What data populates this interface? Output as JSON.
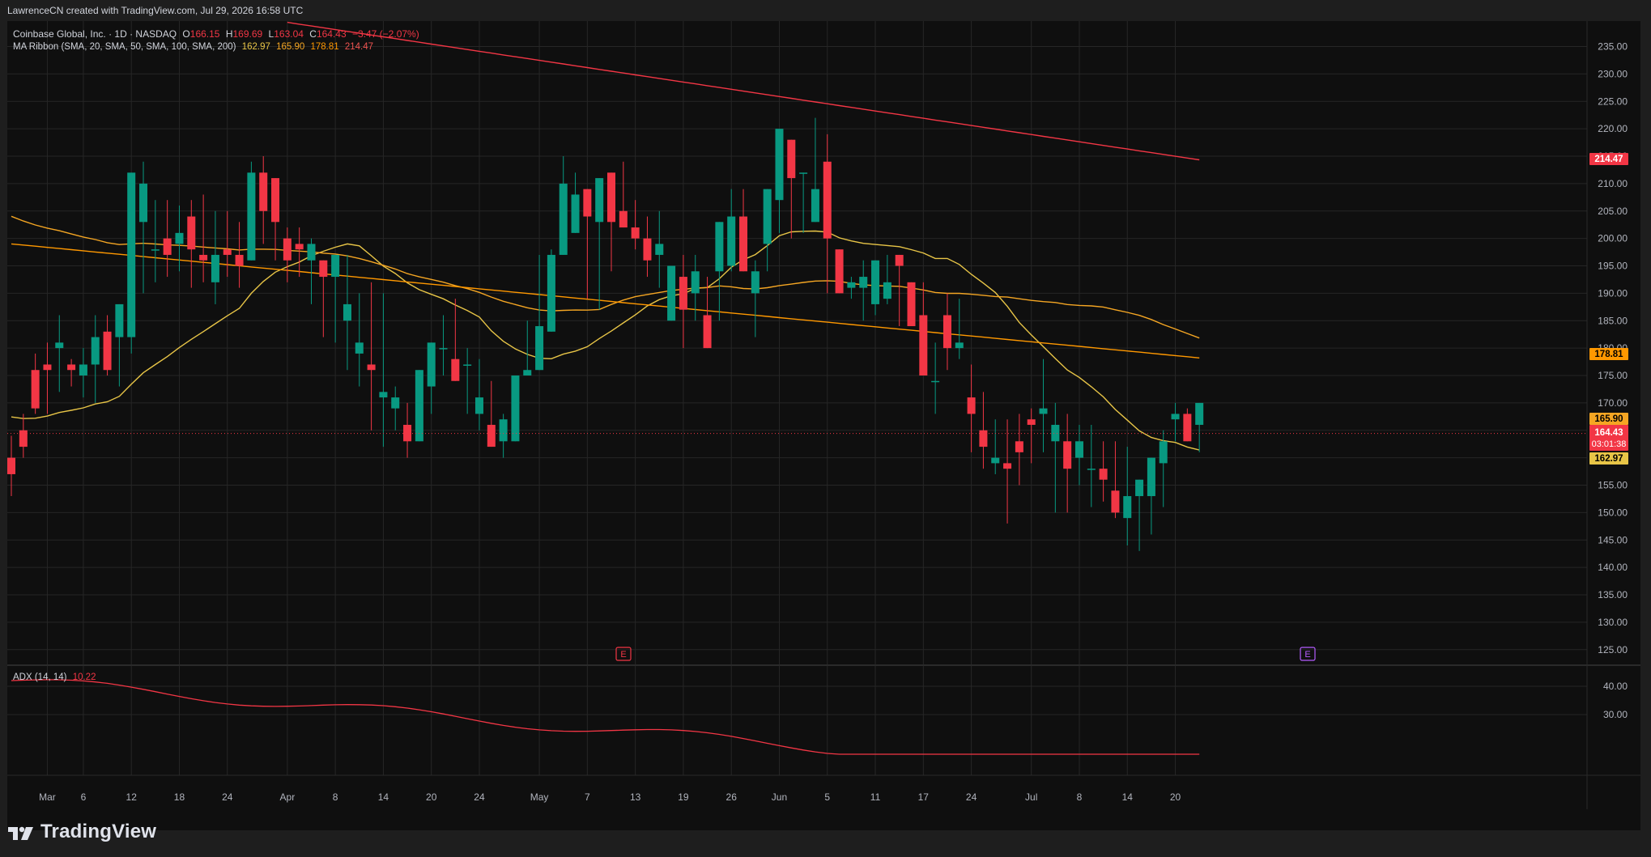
{
  "header": {
    "attribution": "LawrenceCN created with TradingView.com, Jul 29, 2026 16:58 UTC"
  },
  "legend": {
    "symbol": "Coinbase Global, Inc. · 1D · NASDAQ",
    "o_label": "O",
    "o": "166.15",
    "h_label": "H",
    "h": "169.69",
    "l_label": "L",
    "l": "163.04",
    "c_label": "C",
    "c": "164.43",
    "change": "−3.47 (−2.07%)",
    "ma_label": "MA Ribbon (SMA, 20, SMA, 50, SMA, 100, SMA, 200)",
    "ma20": "162.97",
    "ma50": "165.90",
    "ma100": "178.81",
    "ma200": "214.47"
  },
  "adx": {
    "label": "ADX (14, 14)",
    "value": "10.22"
  },
  "price_badges": {
    "ma200": "214.47",
    "ma100": "178.81",
    "ma50": "165.90",
    "last": "164.43",
    "countdown": "03:01:38",
    "ma20": "162.97"
  },
  "earnings_markers": [
    {
      "label": "E"
    },
    {
      "label": "E"
    }
  ],
  "logo": {
    "text": "TradingView"
  },
  "colors": {
    "background": "#0f0f0f",
    "frame": "#1e1e1e",
    "grid": "#262626",
    "up": "#089981",
    "down": "#f23645",
    "ma20": "#e8c547",
    "ma50": "#f5a623",
    "ma100": "#ff9800",
    "ma200": "#f23645",
    "adx": "#f23645",
    "text": "#b2b5be"
  },
  "chart_data": {
    "type": "candlestick",
    "price_axis": {
      "min": 120,
      "max": 237,
      "ticks": [
        "125.00",
        "130.00",
        "135.00",
        "140.00",
        "145.00",
        "150.00",
        "155.00",
        "160.00",
        "165.00",
        "170.00",
        "175.00",
        "180.00",
        "185.00",
        "190.00",
        "195.00",
        "200.00",
        "205.00",
        "210.00",
        "215.00",
        "220.00",
        "225.00",
        "230.00",
        "235.00"
      ]
    },
    "adx_axis": {
      "ticks": [
        "40.00",
        "30.00"
      ]
    },
    "time_axis": {
      "labels": [
        {
          "t": "Mar",
          "i": 3
        },
        {
          "t": "6",
          "i": 6
        },
        {
          "t": "12",
          "i": 10
        },
        {
          "t": "18",
          "i": 14
        },
        {
          "t": "24",
          "i": 18
        },
        {
          "t": "Apr",
          "i": 23
        },
        {
          "t": "8",
          "i": 27
        },
        {
          "t": "14",
          "i": 31
        },
        {
          "t": "20",
          "i": 35
        },
        {
          "t": "24",
          "i": 39
        },
        {
          "t": "May",
          "i": 44
        },
        {
          "t": "7",
          "i": 48
        },
        {
          "t": "13",
          "i": 52
        },
        {
          "t": "19",
          "i": 56
        },
        {
          "t": "26",
          "i": 60
        },
        {
          "t": "Jun",
          "i": 64
        },
        {
          "t": "5",
          "i": 68
        },
        {
          "t": "11",
          "i": 72
        },
        {
          "t": "17",
          "i": 76
        },
        {
          "t": "24",
          "i": 80
        },
        {
          "t": "Jul",
          "i": 85
        },
        {
          "t": "8",
          "i": 89
        },
        {
          "t": "14",
          "i": 93
        },
        {
          "t": "20",
          "i": 97
        }
      ]
    },
    "candles": [
      [
        160,
        164,
        153,
        157
      ],
      [
        165,
        168,
        160,
        162
      ],
      [
        176,
        179,
        168,
        169
      ],
      [
        177,
        181,
        168,
        176
      ],
      [
        180,
        186,
        172,
        181
      ],
      [
        177,
        178,
        173,
        176
      ],
      [
        175,
        180,
        171,
        177
      ],
      [
        177,
        186,
        170,
        182
      ],
      [
        183,
        186,
        175,
        176
      ],
      [
        182,
        188,
        173,
        188
      ],
      [
        182,
        205,
        179,
        212
      ],
      [
        203,
        214,
        190,
        210
      ],
      [
        198,
        207,
        192,
        198
      ],
      [
        200,
        207,
        193,
        197
      ],
      [
        199,
        206,
        194,
        201
      ],
      [
        204,
        207,
        191,
        198
      ],
      [
        197,
        208,
        192,
        196
      ],
      [
        192,
        205,
        188,
        197
      ],
      [
        198,
        205,
        193,
        197
      ],
      [
        197,
        203,
        191,
        195
      ],
      [
        196,
        214,
        197,
        212
      ],
      [
        212,
        215,
        199,
        205
      ],
      [
        211,
        206,
        196,
        203
      ],
      [
        200,
        202,
        192,
        196
      ],
      [
        199,
        202,
        193,
        198
      ],
      [
        196,
        200,
        188,
        199
      ],
      [
        196,
        190,
        182,
        193
      ],
      [
        193,
        194,
        181,
        197
      ],
      [
        185,
        197,
        176,
        188
      ],
      [
        179,
        190,
        173,
        181
      ],
      [
        177,
        192,
        165,
        176
      ],
      [
        171,
        190,
        162,
        172
      ],
      [
        169,
        173,
        165,
        171
      ],
      [
        166,
        170,
        160,
        163
      ],
      [
        163,
        174,
        164,
        176
      ],
      [
        173,
        180,
        168,
        181
      ],
      [
        180,
        186,
        175,
        180
      ],
      [
        178,
        189,
        174,
        174
      ],
      [
        177,
        180,
        168,
        177
      ],
      [
        168,
        178,
        165,
        171
      ],
      [
        166,
        174,
        163,
        162
      ],
      [
        163,
        168,
        160,
        167
      ],
      [
        163,
        175,
        165,
        175
      ],
      [
        175,
        185,
        180,
        176
      ],
      [
        176,
        197,
        190,
        184
      ],
      [
        183,
        198,
        196,
        197
      ],
      [
        197,
        215,
        198,
        210
      ],
      [
        201,
        212,
        206,
        208
      ],
      [
        209,
        205,
        189,
        204
      ],
      [
        203,
        211,
        187,
        211
      ],
      [
        212,
        203,
        194,
        203
      ],
      [
        205,
        214,
        203,
        202
      ],
      [
        202,
        207,
        198,
        200
      ],
      [
        200,
        204,
        193,
        196
      ],
      [
        197,
        205,
        191,
        199
      ],
      [
        185,
        193,
        188,
        195
      ],
      [
        193,
        197,
        180,
        187
      ],
      [
        190,
        197,
        185,
        194
      ],
      [
        186,
        193,
        183,
        180
      ],
      [
        194,
        197,
        185,
        203
      ],
      [
        195,
        209,
        194,
        204
      ],
      [
        204,
        209,
        195,
        194
      ],
      [
        190,
        196,
        182,
        194
      ],
      [
        199,
        205,
        194,
        209
      ],
      [
        207,
        218,
        201,
        220
      ],
      [
        218,
        212,
        200,
        211
      ],
      [
        212,
        205,
        201,
        212
      ],
      [
        203,
        222,
        206,
        209
      ],
      [
        214,
        219,
        190,
        200
      ],
      [
        198,
        197,
        193,
        190
      ],
      [
        191,
        193,
        189,
        192
      ],
      [
        191,
        196,
        185,
        193
      ],
      [
        188,
        193,
        186,
        196
      ],
      [
        189,
        197,
        188,
        192
      ],
      [
        197,
        190,
        184,
        195
      ],
      [
        192,
        190,
        187,
        184
      ],
      [
        186,
        192,
        182,
        175
      ],
      [
        174,
        181,
        168,
        174
      ],
      [
        186,
        190,
        176,
        180
      ],
      [
        180,
        189,
        178,
        181
      ],
      [
        171,
        177,
        161,
        168
      ],
      [
        165,
        172,
        158,
        162
      ],
      [
        159,
        167,
        157,
        160
      ],
      [
        159,
        167,
        148,
        158
      ],
      [
        163,
        168,
        155,
        161
      ],
      [
        167,
        169,
        159,
        166
      ],
      [
        168,
        178,
        161,
        169
      ],
      [
        163,
        170,
        150,
        166
      ],
      [
        163,
        168,
        150,
        158
      ],
      [
        160,
        166,
        155,
        163
      ],
      [
        158,
        166,
        151,
        158
      ],
      [
        158,
        163,
        152,
        156
      ],
      [
        154,
        163,
        149,
        150
      ],
      [
        149,
        162,
        144,
        153
      ],
      [
        153,
        155,
        143,
        156
      ],
      [
        153,
        156,
        146,
        160
      ],
      [
        159,
        165,
        151,
        163
      ],
      [
        167,
        170,
        163,
        168
      ],
      [
        168,
        169,
        163,
        163
      ],
      [
        166,
        168,
        161,
        170
      ]
    ],
    "ma20": [],
    "ma50": [],
    "ma100": [],
    "ma200": [],
    "adx": []
  }
}
